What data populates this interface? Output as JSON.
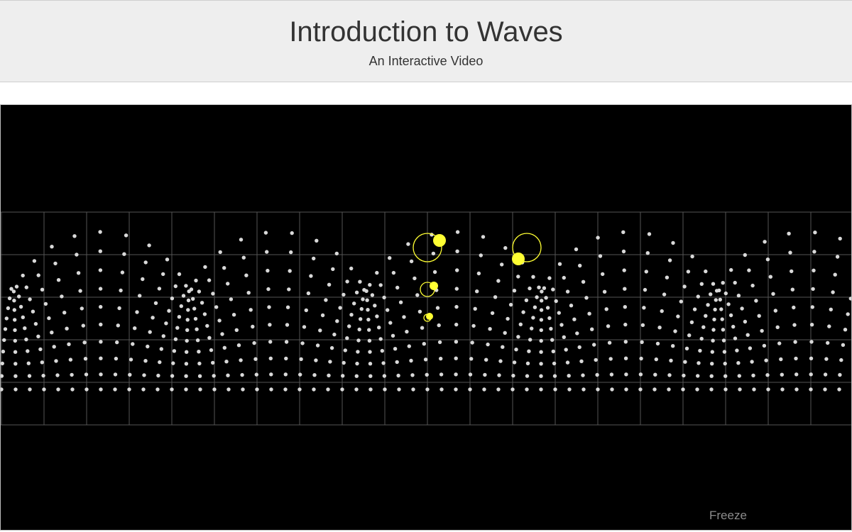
{
  "header": {
    "title": "Introduction to Waves",
    "subtitle": "An Interactive Video"
  },
  "controls": {
    "freeze_label": "Freeze"
  },
  "colors": {
    "header_bg": "#eeeeee",
    "stage_bg": "#000000",
    "grid": "#555555",
    "particle": "#d9d9d9",
    "highlight": "#ffff33",
    "text": "#333333",
    "freeze_text": "#8c8c8c"
  }
}
